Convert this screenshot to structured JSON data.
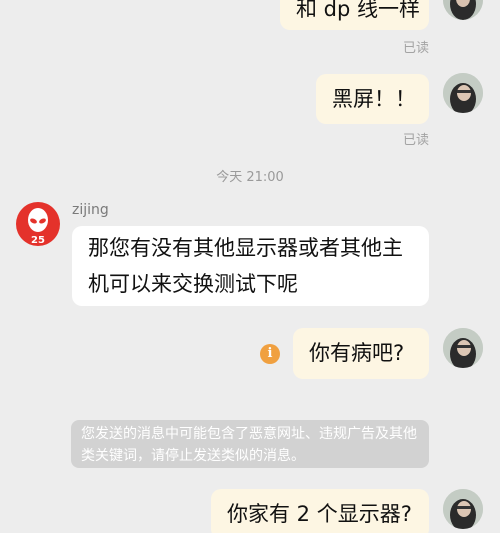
{
  "messages": {
    "m1": {
      "text": "和 dp 线一样",
      "status": "已读"
    },
    "m2": {
      "text": "黑屏！！",
      "status": "已读"
    },
    "time_separator": "今天 21:00",
    "m3": {
      "sender": "zijing",
      "text": "那您有没有其他显示器或者其他主机可以来交换测试下呢"
    },
    "m4": {
      "text": "你有病吧?",
      "icon": "info-icon"
    },
    "system_notice": "您发送的消息中可能包含了恶意网址、违规广告及其他类关键词，请停止发送类似的消息。",
    "m5": {
      "text": "你家有 2 个显示器?"
    }
  },
  "colors": {
    "background": "#ededed",
    "outgoing_bubble": "#fdf6e3",
    "incoming_bubble": "#ffffff",
    "notice_bg": "#d2d2d2",
    "info_icon": "#f0a040",
    "brand_avatar": "#e4322b"
  }
}
